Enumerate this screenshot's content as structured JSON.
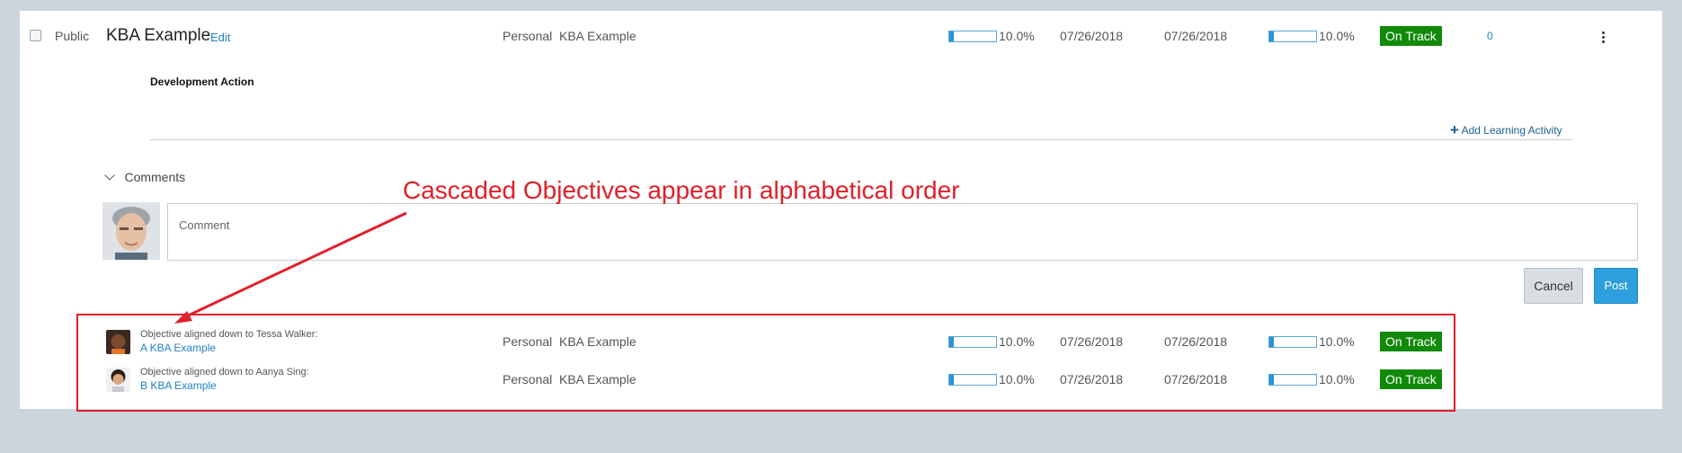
{
  "main_row": {
    "visibility": "Public",
    "title": "KBA Example",
    "edit_label": "Edit",
    "category": "Personal",
    "parent": "KBA Example",
    "progress1": 0.1,
    "progress1_text": "10.0%",
    "start_date": "07/26/2018",
    "due_date": "07/26/2018",
    "progress2": 0.1,
    "progress2_text": "10.0%",
    "status": "On Track",
    "count": "0"
  },
  "development_action_heading": "Development Action",
  "add_learning_activity": "Add Learning Activity",
  "comments": {
    "heading": "Comments",
    "placeholder": "Comment",
    "cancel_label": "Cancel",
    "post_label": "Post"
  },
  "annotation": "Cascaded Objectives appear in alphabetical order",
  "cascaded": [
    {
      "aligned_text": "Objective aligned down to Tessa Walker:",
      "link": "A KBA Example",
      "category": "Personal",
      "parent": "KBA Example",
      "progress1": 0.1,
      "progress1_text": "10.0%",
      "start_date": "07/26/2018",
      "due_date": "07/26/2018",
      "progress2": 0.1,
      "progress2_text": "10.0%",
      "status": "On Track"
    },
    {
      "aligned_text": "Objective aligned down to Aanya Sing:",
      "link": "B KBA Example",
      "category": "Personal",
      "parent": "KBA Example",
      "progress1": 0.1,
      "progress1_text": "10.0%",
      "start_date": "07/26/2018",
      "due_date": "07/26/2018",
      "progress2": 0.1,
      "progress2_text": "10.0%",
      "status": "On Track"
    }
  ],
  "colors": {
    "status_green": "#118a0a",
    "link_blue": "#1f83c4",
    "annotation_red": "#e0202a",
    "post_blue": "#2d9fdc"
  }
}
